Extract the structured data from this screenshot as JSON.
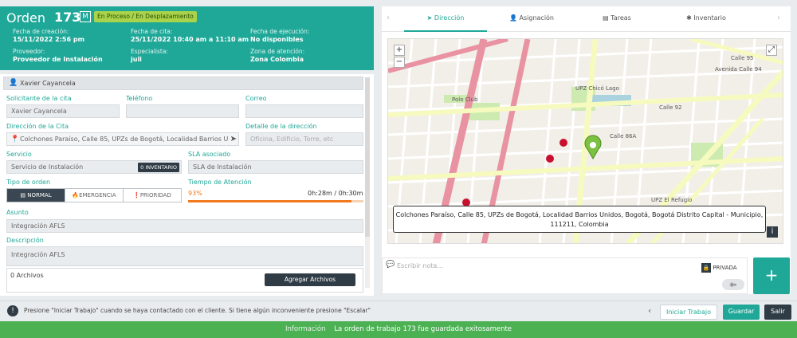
{
  "header": {
    "title": "Orden",
    "number": "173",
    "tag": "M",
    "status": "En Proceso / En Desplazamiento",
    "fields": [
      {
        "label": "Fecha de creación:",
        "value": "15/11/2022 2:56 pm"
      },
      {
        "label": "Fecha de cita:",
        "value": "25/11/2022 10:40 am a 11:10 am"
      },
      {
        "label": "Fecha de ejecución:",
        "value": "No disponibles"
      },
      {
        "label": "Proveedor:",
        "value": "Proveedor de Instalación"
      },
      {
        "label": "Especialista:",
        "value": "juli"
      },
      {
        "label": "Zona de atención:",
        "value": "Zona Colombia"
      }
    ]
  },
  "form": {
    "user": "Xavier Cayancela",
    "solicitante_label": "Solicitante de la cita",
    "solicitante_value": "Xavier Cayancela",
    "telefono_label": "Teléfono",
    "correo_label": "Correo",
    "direccion_label": "Dirección de la Cita",
    "direccion_value": "Colchones Paraíso, Calle 85, UPZs de Bogotá, Localidad Barrios Uni",
    "detalle_label": "Detalle de la dirección",
    "detalle_placeholder": "Oficina, Edificio, Torre, etc",
    "servicio_label": "Servicio",
    "servicio_value": "Servicio de Instalación",
    "inventario_badge": "0 INVENTARIO",
    "sla_label": "SLA asociado",
    "sla_value": "SLA de Instalación",
    "tipo_label": "Tipo de orden",
    "tipo_options": [
      "NORMAL",
      "EMERGENCIA",
      "PRIORIDAD"
    ],
    "tiempo_label": "Tiempo de Atención",
    "tiempo_percent": "93%",
    "tiempo_value": "0h:28m / 0h:30m",
    "asunto_label": "Asunto",
    "asunto_value": "Integración AFLS",
    "descripcion_label": "Descripción",
    "descripcion_value": "Integración AFLS",
    "archivos": "0 Archivos",
    "agregar_archivos": "Agregar Archivos"
  },
  "tabs": [
    {
      "label": "Dirección",
      "icon": "location-arrow-icon"
    },
    {
      "label": "Asignación",
      "icon": "user-icon"
    },
    {
      "label": "Tareas",
      "icon": "list-icon"
    },
    {
      "label": "Inventario",
      "icon": "tools-icon"
    }
  ],
  "map": {
    "popup": "Colchones Paraíso, Calle 85, UPZs de Bogotá, Localidad Barrios Unidos, Bogotá, Bogotá Distrito Capital - Municipio, 111211, Colombia",
    "labels": [
      "Calle 95",
      "Avenida Calle 94",
      "Polo Club",
      "UPZ Chicó Lago",
      "Avenida Carrera 20",
      "Avenida Carrera 15",
      "Calle 92",
      "Calle 86A",
      "Avenida Calle 82",
      "UPZ El Refugio",
      "Avenida Carrera 9"
    ]
  },
  "note": {
    "placeholder": "Escribir nota...",
    "privada": "PRIVADA"
  },
  "bottom": {
    "hint": "Presione \"Iniciar Trabajo\" cuando se haya contactado con el cliente. Si tiene algún inconveniente presione \"Escalar\"",
    "iniciar": "Iniciar Trabajo",
    "guardar": "Guardar",
    "salir": "Salir"
  },
  "toast": {
    "label": "Información",
    "message": "La orden de trabajo 173 fue guardada exitosamente"
  }
}
